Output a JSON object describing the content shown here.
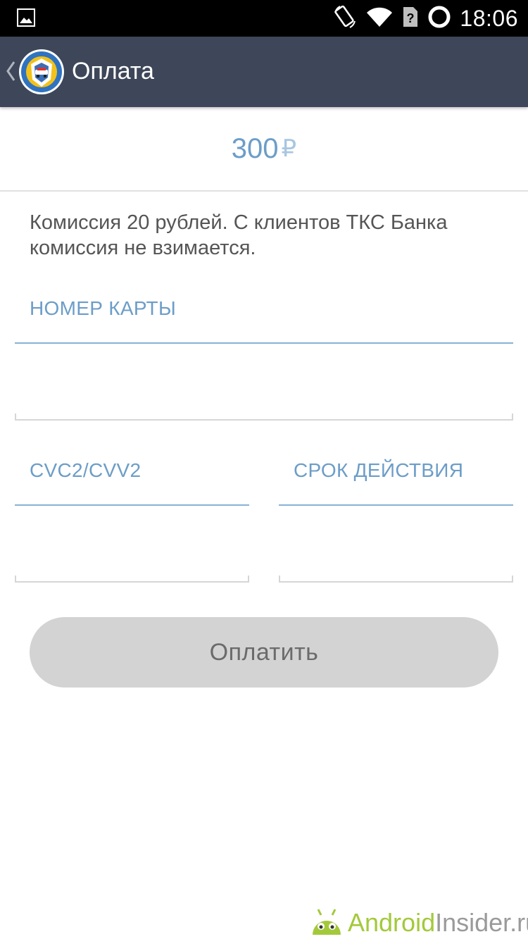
{
  "status_bar": {
    "time": "18:06",
    "icons": [
      "image-notification-icon",
      "rotate-icon",
      "wifi-icon",
      "no-sim-icon",
      "battery-ring-icon"
    ]
  },
  "action_bar": {
    "title": "Оплата",
    "back_icon": "chevron-left-icon",
    "logo_icon": "gibdd-emblem-icon"
  },
  "payment": {
    "amount": "300",
    "currency": "₽",
    "commission": "Комиссия 20 рублей. С клиентов ТКС Банка комиссия не взимается."
  },
  "form": {
    "card_number_label": "НОМЕР КАРТЫ",
    "card_number_value": "",
    "cvc_label": "CVC2/CVV2",
    "cvc_value": "",
    "expiry_label": "СРОК ДЕЙСТВИЯ",
    "expiry_value": ""
  },
  "buttons": {
    "pay_label": "Оплатить"
  },
  "watermark": {
    "part1": "Android",
    "part2": "Insider.ru"
  },
  "colors": {
    "action_bar": "#3d4759",
    "accent_blue": "#6c9dc8",
    "button_bg": "#d3d3d3",
    "watermark_green": "#a3c93a"
  }
}
